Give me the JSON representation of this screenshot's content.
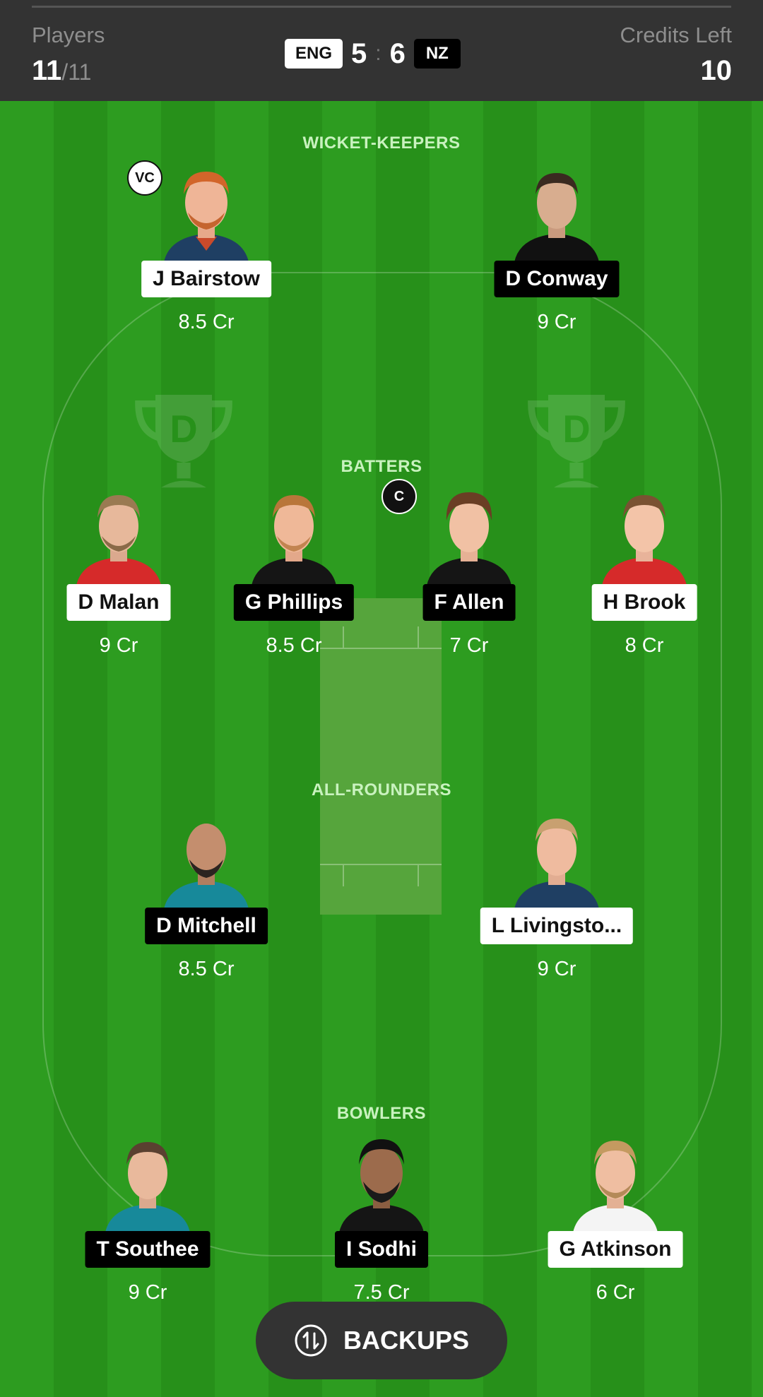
{
  "header": {
    "players_label": "Players",
    "players_selected": "11",
    "players_total": "/11",
    "credits_label": "Credits Left",
    "credits_value": "10",
    "team1": "ENG",
    "team1_count": "5",
    "separator": ":",
    "team2_count": "6",
    "team2": "NZ"
  },
  "sections": {
    "wicket_keepers": "WICKET-KEEPERS",
    "batters": "BATTERS",
    "all_rounders": "ALL-ROUNDERS",
    "bowlers": "BOWLERS"
  },
  "players": {
    "bairstow": {
      "name": "J Bairstow",
      "credits": "8.5 Cr",
      "badge": "VC",
      "team": "ENG"
    },
    "conway": {
      "name": "D Conway",
      "credits": "9 Cr",
      "team": "NZ"
    },
    "malan": {
      "name": "D Malan",
      "credits": "9 Cr",
      "team": "ENG"
    },
    "phillips": {
      "name": "G Phillips",
      "credits": "8.5 Cr",
      "team": "NZ"
    },
    "allen": {
      "name": "F Allen",
      "credits": "7 Cr",
      "badge": "C",
      "team": "NZ"
    },
    "brook": {
      "name": "H Brook",
      "credits": "8 Cr",
      "team": "ENG"
    },
    "mitchell": {
      "name": "D Mitchell",
      "credits": "8.5 Cr",
      "team": "NZ"
    },
    "livingstone": {
      "name": "L Livingsto...",
      "credits": "9 Cr",
      "team": "ENG"
    },
    "southee": {
      "name": "T Southee",
      "credits": "9 Cr",
      "team": "NZ"
    },
    "sodhi": {
      "name": "I Sodhi",
      "credits": "7.5 Cr",
      "team": "NZ"
    },
    "atkinson": {
      "name": "G Atkinson",
      "credits": "6 Cr",
      "team": "ENG"
    }
  },
  "backups": {
    "label": "BACKUPS",
    "icon": "swap-icon"
  },
  "colors": {
    "field": "#2a9a1e",
    "header": "#333333",
    "section_title": "#c9f2bf"
  }
}
